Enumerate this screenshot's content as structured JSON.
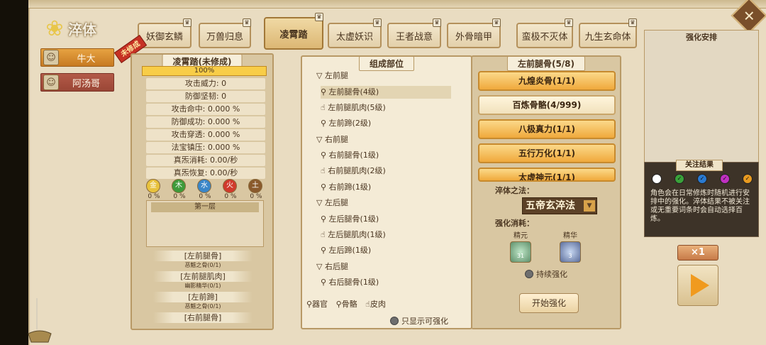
{
  "title": "淬体",
  "characters": [
    {
      "name": "牛大",
      "selected": true
    },
    {
      "name": "阿汤哥",
      "selected": false
    }
  ],
  "tabs": [
    {
      "label": "妖御玄鳞",
      "badge": "♛"
    },
    {
      "label": "万兽归息",
      "badge": "♛"
    },
    {
      "label": "凌霄踏",
      "badge": "♛",
      "active": true
    },
    {
      "label": "太虚妖识",
      "badge": "♛"
    },
    {
      "label": "王者战意",
      "badge": "♛"
    },
    {
      "label": "外骨暗甲",
      "badge": "♛"
    },
    {
      "label": "蛮极不灭体",
      "badge": "♛"
    },
    {
      "label": "九生玄命体",
      "badge": "♛"
    }
  ],
  "ribbon": "未修成",
  "stats": {
    "header": "凌霄踏(未修成)",
    "progress": "100%",
    "rows": [
      "攻击威力: 0",
      "防御坚韧: 0",
      "攻击命中: 0.000 %",
      "防御成功: 0.000 %",
      "攻击穿透: 0.000 %",
      "法宝镇压: 0.000 %",
      "真炁消耗: 0.00/秒",
      "真炁恢复: 0.00/秒"
    ],
    "elements": [
      {
        "name": "金",
        "pct": "0 %",
        "color": "#e8c23c"
      },
      {
        "name": "木",
        "pct": "0 %",
        "color": "#3e9a3a"
      },
      {
        "name": "水",
        "pct": "0 %",
        "color": "#3a86c8"
      },
      {
        "name": "火",
        "pct": "0 %",
        "color": "#d03a2c"
      },
      {
        "name": "土",
        "pct": "0 %",
        "color": "#8a5a2c"
      }
    ],
    "layer_title": "第一层",
    "parts": [
      {
        "name": "[左前腿骨]",
        "sub": "恶魃之骨(0/1)"
      },
      {
        "name": "[左前腿肌肉]",
        "sub": "幽影精华(0/1)"
      },
      {
        "name": "[左前蹄]",
        "sub": "恶魃之骨(0/1)"
      },
      {
        "name": "[右前腿骨]",
        "sub": ""
      }
    ]
  },
  "tree": {
    "header": "组成部位",
    "items": [
      {
        "label": "▽ 左前腿",
        "type": "group"
      },
      {
        "label": "⚲ 左前腿骨(4级)",
        "type": "sub",
        "selected": true
      },
      {
        "label": "☝ 左前腿肌肉(5级)",
        "type": "sub"
      },
      {
        "label": "⚲ 左前蹄(2级)",
        "type": "sub"
      },
      {
        "label": "▽ 右前腿",
        "type": "group"
      },
      {
        "label": "⚲ 右前腿骨(1级)",
        "type": "sub"
      },
      {
        "label": "☝ 右前腿肌肉(2级)",
        "type": "sub"
      },
      {
        "label": "⚲ 右前蹄(1级)",
        "type": "sub"
      },
      {
        "label": "▽ 左后腿",
        "type": "group"
      },
      {
        "label": "⚲ 左后腿骨(1级)",
        "type": "sub"
      },
      {
        "label": "☝ 左后腿肌肉(1级)",
        "type": "sub"
      },
      {
        "label": "⚲ 左后蹄(1级)",
        "type": "sub"
      },
      {
        "label": "▽ 右后腿",
        "type": "group"
      },
      {
        "label": "⚲ 右后腿骨(1级)",
        "type": "sub"
      }
    ],
    "legend": [
      "⚲器官",
      "⚲骨骼",
      "☝皮肉"
    ],
    "only_strengthenable": "只显示可强化"
  },
  "materials": {
    "header": "左前腿骨(5/8)",
    "buttons": [
      {
        "label": "九煌炎骨(1/1)",
        "style": "gold"
      },
      {
        "label": "百炼骨骼(4/999)",
        "style": "pale"
      },
      {
        "label": "八极真力(1/1)",
        "style": "gold"
      },
      {
        "label": "五行万化(1/1)",
        "style": "gold"
      },
      {
        "label": "太虚神元(1/1)",
        "style": "gold"
      }
    ],
    "method_label": "淬体之法：",
    "method_value": "五帝玄淬法",
    "cost_label": "强化消耗：",
    "costs": [
      {
        "name": "精元",
        "count": "31"
      },
      {
        "name": "精华",
        "count": "3"
      }
    ],
    "continuous": "持续强化",
    "start": "开始强化"
  },
  "plan": {
    "title": "强化安排"
  },
  "focus": {
    "title": "关注结果",
    "options": [
      "",
      "✓",
      "✓",
      "✓",
      "✓"
    ],
    "option_colors": [
      "#ffffff",
      "#3aa23a",
      "#2a7ad0",
      "#c030c0",
      "#e89a20"
    ],
    "desc": "角色会在日常修炼时随机进行安排中的强化。淬体结果不被关注或无重要词条时会自动选择百炼。"
  },
  "multiplier": "×1"
}
